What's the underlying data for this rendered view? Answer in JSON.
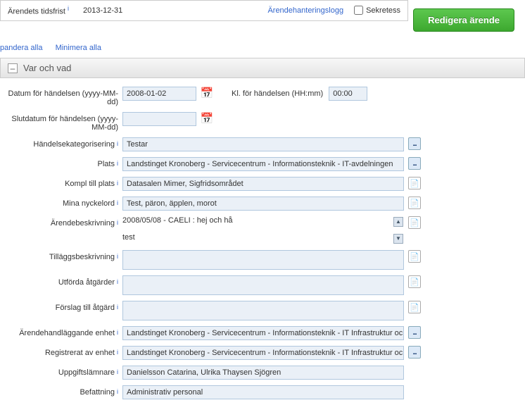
{
  "topbar": {
    "deadline_label": "Ärendets tidsfrist",
    "deadline_value": "2013-12-31",
    "log_link": "Ärendehanteringslogg",
    "sekretess_label": "Sekretess"
  },
  "edit_button": "Redigera ärende",
  "toolbar": {
    "expand_all": "pandera alla",
    "minimize_all": "Minimera alla"
  },
  "section_title": "Var och vad",
  "labels": {
    "event_date": "Datum för händelsen (yyyy-MM-dd)",
    "event_time": "Kl. för händelsen (HH:mm)",
    "end_date": "Slutdatum för händelsen (yyyy-MM-dd)",
    "category": "Händelsekategorisering",
    "plats": "Plats",
    "kompl_plats": "Kompl till plats",
    "keywords": "Mina nyckelord",
    "description": "Ärendebeskrivning",
    "additional": "Tilläggsbeskrivning",
    "actions": "Utförda åtgärder",
    "suggestion": "Förslag till åtgärd",
    "handling_unit": "Ärendehandläggande enhet",
    "registered_by": "Registrerat av enhet",
    "reporter": "Uppgiftslämnare",
    "position": "Befattning"
  },
  "values": {
    "event_date": "2008-01-02",
    "event_time": "00:00",
    "category": "Testar",
    "plats": "Landstinget Kronoberg - Servicecentrum - Informationsteknik - IT-avdelningen",
    "kompl_plats": "Datasalen Mimer, Sigfridsområdet",
    "keywords": "Test, päron, äpplen, morot",
    "description": "2008/05/08 - CAELI : hej och hå\n\ntest",
    "handling_unit": "Landstinget Kronoberg - Servicecentrum - Informationsteknik - IT Infrastruktur och",
    "registered_by": "Landstinget Kronoberg - Servicecentrum - Informationsteknik - IT Infrastruktur och",
    "reporter": "Danielsson Catarina, Ulrika Thaysen Sjögren",
    "position": "Administrativ personal"
  }
}
